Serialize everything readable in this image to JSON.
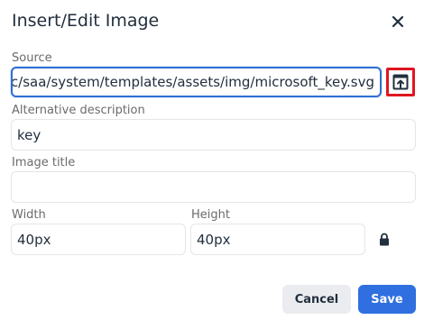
{
  "dialog": {
    "title": "Insert/Edit Image",
    "close_icon": "close-icon"
  },
  "source": {
    "label": "Source",
    "value": "atic/saa/system/templates/assets/img/microsoft_key.svg",
    "browse_icon": "browse-upload-icon"
  },
  "alt": {
    "label": "Alternative description",
    "value": "key"
  },
  "image_title": {
    "label": "Image title",
    "value": ""
  },
  "dimensions": {
    "width_label": "Width",
    "width_value": "40px",
    "height_label": "Height",
    "height_value": "40px",
    "lock_icon": "lock-icon"
  },
  "buttons": {
    "cancel": "Cancel",
    "save": "Save"
  },
  "colors": {
    "accent": "#2f6fe0",
    "focus_border": "#2f6fd3",
    "highlight_red": "#e0161f"
  }
}
